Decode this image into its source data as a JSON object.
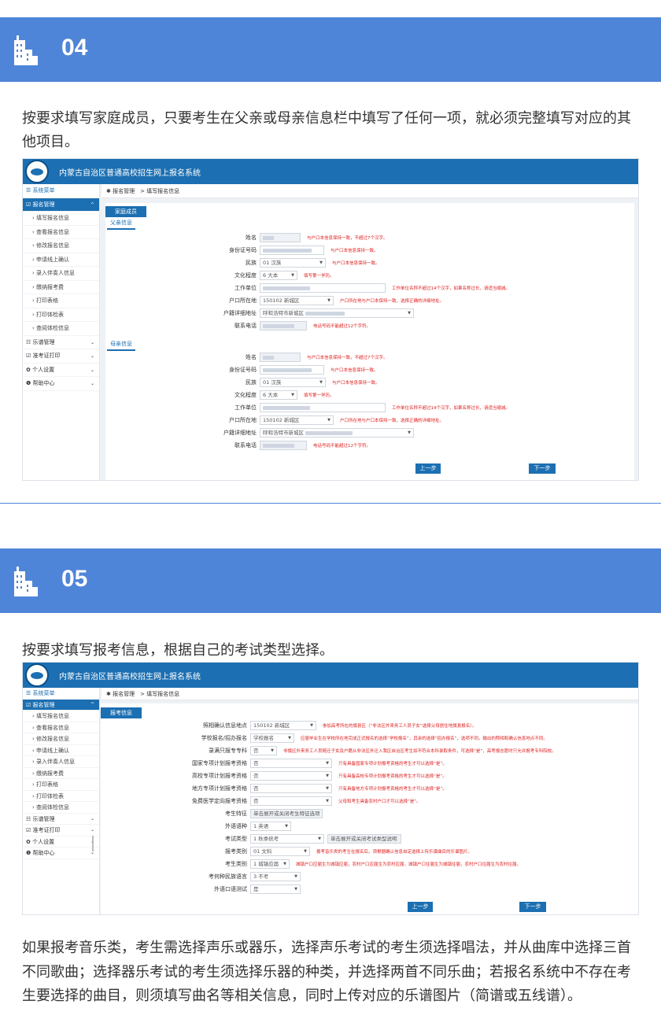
{
  "sec04": {
    "num": "04"
  },
  "sec05": {
    "num": "05"
  },
  "para1": "按要求填写家庭成员，只要考生在父亲或母亲信息栏中填写了任何一项，就必须完整填写对应的其他项目。",
  "para2": "按要求填写报考信息，根据自己的考试类型选择。",
  "para3": "如果报考音乐类，考生需选择声乐或器乐，选择声乐考试的考生须选择唱法，并从曲库中选择三首不同歌曲；选择器乐考试的考生须选择乐器的种类，并选择两首不同乐曲；若报名系统中不存在考生要选择的曲目，则须填写曲名等相关信息，同时上传对应的乐谱图片（简谱或五线谱）。",
  "app": {
    "title": "内蒙古自治区普通高校招生网上报名系统",
    "breadcrumb": "✱ 报名管理　> 填写报名信息",
    "menu_title": "☰ 系统菜单",
    "menu": {
      "reg": "☑ 报名管理",
      "items": [
        "› 填写报名信息",
        "› 查看报名信息",
        "› 修改报名信息",
        "› 申请线上确认",
        "› 录入伴奏人信息",
        "› 缴纳报考费",
        "› 打印表格",
        "› 打印体检表",
        "› 查阅体检信息"
      ],
      "music": "☷ 乐谱管理",
      "admit": "☑ 准考证打印",
      "personal": "✿ 个人设置",
      "help": "❶ 帮助中心"
    },
    "prev": "上一步",
    "next": "下一步"
  },
  "family": {
    "tab": "家庭成员",
    "father_title": "父亲信息",
    "mother_title": "母亲信息",
    "labels": {
      "name": "姓名",
      "id": "身份证号码",
      "nation": "民族",
      "edu": "文化程度",
      "work": "工作单位",
      "hukou": "户口所在地",
      "addr": "户籍详细地址",
      "phone": "联系电话"
    },
    "values": {
      "nation": "01 汉族",
      "edu": "6 大本",
      "hukou": "150102 新城区",
      "addr": "呼和浩特市新城区"
    },
    "hints": {
      "name": "与户口本信息保持一致，不超过7个汉字。",
      "id": "与户口本信息保持一致。",
      "nation": "与户口本信息保持一致。",
      "edu": "填写第一学历。",
      "work": "工作单位名称不超过14个汉字，如果名称过长，请适当缩减。",
      "hukou": "户口所在地与户口本保持一致，选择正确的详细地址。",
      "phone": "电话号码不能超过12个字符。"
    }
  },
  "exam": {
    "tab": "报考信息",
    "rows": [
      {
        "label": "照相确认信息地点",
        "value": "150102 新城区",
        "hint": "参加高考所在的旗县区（“非法区外来务工人员子女”选择父母居住地旗县报名）。"
      },
      {
        "label": "学校报名/招办报名",
        "value": "学校报名",
        "hint": "应届毕业生在学校所在地完成正式报名的选择“学校报名”，其余的选择“招办报名”，选项不同，输出的照相和确认信息地点不同。"
      },
      {
        "label": "录满只报专专科",
        "value": "否",
        "hint": "非旗区外来务工人员随迁子女及户籍从非法区外迁入我区自治区考生如不符合本科录取条件，可选择“是”，高考报志愿时只允许报考专科院校。"
      },
      {
        "label": "国家专项计划报考资格",
        "value": "否",
        "hint": "只有具备国家专项计划报考资格的考生才可以选择“是”。"
      },
      {
        "label": "高校专项计划报考资格",
        "value": "否",
        "hint": "只有具备高校专项计划报考资格的考生才可以选择“是”。"
      },
      {
        "label": "地方专项计划报考资格",
        "value": "否",
        "hint": "只有具备地方专项计划报考资格的考生才可以选择“是”。"
      },
      {
        "label": "免费医学定向报考资格",
        "value": "否",
        "hint": "父母和考生具备农村户口才可以选择“是”。"
      },
      {
        "label": "考生特征",
        "value": "单击展开或关闭考生特征选项",
        "hint": ""
      },
      {
        "label": "外语语种",
        "value": "1 英语",
        "hint": ""
      },
      {
        "label": "考试类型",
        "value": "1 秋季统考",
        "hint": ""
      },
      {
        "label": "报考类别",
        "value": "01 文科",
        "hint": "报考音乐类的考生在报名后，须根据确认信息自定选择上传乐谱曲目的乐谱图片。"
      },
      {
        "label": "考生类别",
        "value": "1 城镇应届",
        "hint": "城镇户口应届生为城镇应届，农村户口应届生为农村应届，城镇户口往届生为城镇往届，农村户口往届生为农村往届。"
      },
      {
        "label": "考何种民族语言",
        "value": "3 不考",
        "hint": ""
      },
      {
        "label": "外语口语测试",
        "value": "是",
        "hint": ""
      }
    ],
    "type_button": "单击展开或关闭考试类型说明"
  }
}
